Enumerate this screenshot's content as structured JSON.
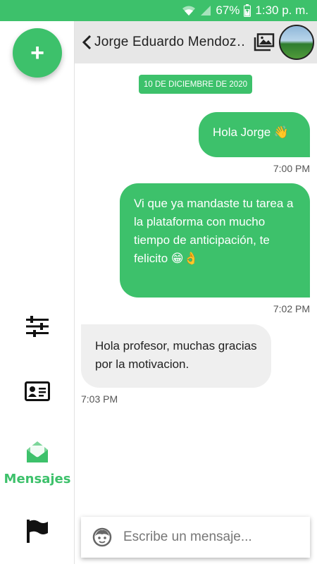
{
  "status_bar": {
    "battery_percent": "67%",
    "time": "1:30 p. m."
  },
  "sidebar": {
    "fab_label": "+",
    "items": [
      {
        "name": "filters",
        "label": ""
      },
      {
        "name": "contact-card",
        "label": ""
      },
      {
        "name": "messages",
        "label": "Mensajes"
      },
      {
        "name": "flag",
        "label": ""
      }
    ]
  },
  "header": {
    "contact_name": "Jorge Eduardo Mendoz…"
  },
  "chat": {
    "date": "10 DE DICIEMBRE DE 2020",
    "messages": [
      {
        "direction": "out",
        "text": "Hola Jorge 👋",
        "time": "7:00 PM"
      },
      {
        "direction": "out",
        "text": "Vi que ya mandaste tu tarea a la plataforma con mucho tiempo de anticipación, te felicito 😁👌",
        "time": "7:02 PM"
      },
      {
        "direction": "in",
        "text": "Hola profesor, muchas gracias por la motivacion.",
        "time": "7:03 PM"
      }
    ]
  },
  "composer": {
    "placeholder": "Escribe un mensaje..."
  },
  "colors": {
    "accent": "#3dc16b",
    "header_bg": "#e7e7e7",
    "incoming_bubble": "#efefef"
  }
}
